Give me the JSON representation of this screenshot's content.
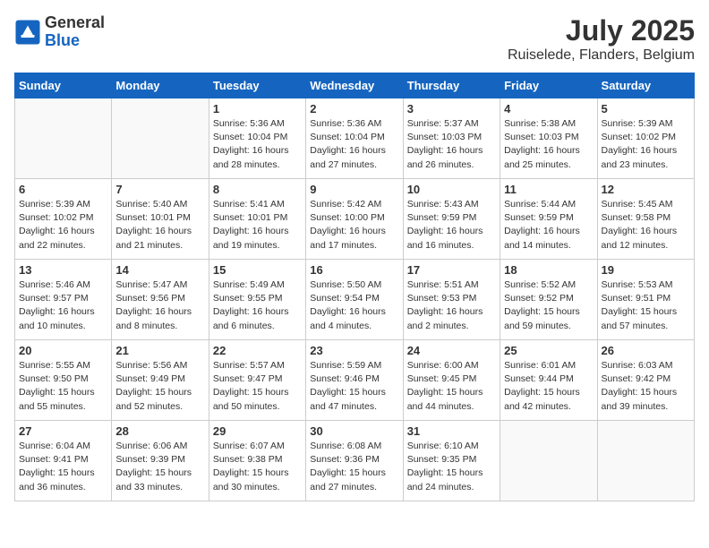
{
  "header": {
    "logo_general": "General",
    "logo_blue": "Blue",
    "month_title": "July 2025",
    "location": "Ruiselede, Flanders, Belgium"
  },
  "weekdays": [
    "Sunday",
    "Monday",
    "Tuesday",
    "Wednesday",
    "Thursday",
    "Friday",
    "Saturday"
  ],
  "weeks": [
    [
      {
        "day": "",
        "info": ""
      },
      {
        "day": "",
        "info": ""
      },
      {
        "day": "1",
        "info": "Sunrise: 5:36 AM\nSunset: 10:04 PM\nDaylight: 16 hours\nand 28 minutes."
      },
      {
        "day": "2",
        "info": "Sunrise: 5:36 AM\nSunset: 10:04 PM\nDaylight: 16 hours\nand 27 minutes."
      },
      {
        "day": "3",
        "info": "Sunrise: 5:37 AM\nSunset: 10:03 PM\nDaylight: 16 hours\nand 26 minutes."
      },
      {
        "day": "4",
        "info": "Sunrise: 5:38 AM\nSunset: 10:03 PM\nDaylight: 16 hours\nand 25 minutes."
      },
      {
        "day": "5",
        "info": "Sunrise: 5:39 AM\nSunset: 10:02 PM\nDaylight: 16 hours\nand 23 minutes."
      }
    ],
    [
      {
        "day": "6",
        "info": "Sunrise: 5:39 AM\nSunset: 10:02 PM\nDaylight: 16 hours\nand 22 minutes."
      },
      {
        "day": "7",
        "info": "Sunrise: 5:40 AM\nSunset: 10:01 PM\nDaylight: 16 hours\nand 21 minutes."
      },
      {
        "day": "8",
        "info": "Sunrise: 5:41 AM\nSunset: 10:01 PM\nDaylight: 16 hours\nand 19 minutes."
      },
      {
        "day": "9",
        "info": "Sunrise: 5:42 AM\nSunset: 10:00 PM\nDaylight: 16 hours\nand 17 minutes."
      },
      {
        "day": "10",
        "info": "Sunrise: 5:43 AM\nSunset: 9:59 PM\nDaylight: 16 hours\nand 16 minutes."
      },
      {
        "day": "11",
        "info": "Sunrise: 5:44 AM\nSunset: 9:59 PM\nDaylight: 16 hours\nand 14 minutes."
      },
      {
        "day": "12",
        "info": "Sunrise: 5:45 AM\nSunset: 9:58 PM\nDaylight: 16 hours\nand 12 minutes."
      }
    ],
    [
      {
        "day": "13",
        "info": "Sunrise: 5:46 AM\nSunset: 9:57 PM\nDaylight: 16 hours\nand 10 minutes."
      },
      {
        "day": "14",
        "info": "Sunrise: 5:47 AM\nSunset: 9:56 PM\nDaylight: 16 hours\nand 8 minutes."
      },
      {
        "day": "15",
        "info": "Sunrise: 5:49 AM\nSunset: 9:55 PM\nDaylight: 16 hours\nand 6 minutes."
      },
      {
        "day": "16",
        "info": "Sunrise: 5:50 AM\nSunset: 9:54 PM\nDaylight: 16 hours\nand 4 minutes."
      },
      {
        "day": "17",
        "info": "Sunrise: 5:51 AM\nSunset: 9:53 PM\nDaylight: 16 hours\nand 2 minutes."
      },
      {
        "day": "18",
        "info": "Sunrise: 5:52 AM\nSunset: 9:52 PM\nDaylight: 15 hours\nand 59 minutes."
      },
      {
        "day": "19",
        "info": "Sunrise: 5:53 AM\nSunset: 9:51 PM\nDaylight: 15 hours\nand 57 minutes."
      }
    ],
    [
      {
        "day": "20",
        "info": "Sunrise: 5:55 AM\nSunset: 9:50 PM\nDaylight: 15 hours\nand 55 minutes."
      },
      {
        "day": "21",
        "info": "Sunrise: 5:56 AM\nSunset: 9:49 PM\nDaylight: 15 hours\nand 52 minutes."
      },
      {
        "day": "22",
        "info": "Sunrise: 5:57 AM\nSunset: 9:47 PM\nDaylight: 15 hours\nand 50 minutes."
      },
      {
        "day": "23",
        "info": "Sunrise: 5:59 AM\nSunset: 9:46 PM\nDaylight: 15 hours\nand 47 minutes."
      },
      {
        "day": "24",
        "info": "Sunrise: 6:00 AM\nSunset: 9:45 PM\nDaylight: 15 hours\nand 44 minutes."
      },
      {
        "day": "25",
        "info": "Sunrise: 6:01 AM\nSunset: 9:44 PM\nDaylight: 15 hours\nand 42 minutes."
      },
      {
        "day": "26",
        "info": "Sunrise: 6:03 AM\nSunset: 9:42 PM\nDaylight: 15 hours\nand 39 minutes."
      }
    ],
    [
      {
        "day": "27",
        "info": "Sunrise: 6:04 AM\nSunset: 9:41 PM\nDaylight: 15 hours\nand 36 minutes."
      },
      {
        "day": "28",
        "info": "Sunrise: 6:06 AM\nSunset: 9:39 PM\nDaylight: 15 hours\nand 33 minutes."
      },
      {
        "day": "29",
        "info": "Sunrise: 6:07 AM\nSunset: 9:38 PM\nDaylight: 15 hours\nand 30 minutes."
      },
      {
        "day": "30",
        "info": "Sunrise: 6:08 AM\nSunset: 9:36 PM\nDaylight: 15 hours\nand 27 minutes."
      },
      {
        "day": "31",
        "info": "Sunrise: 6:10 AM\nSunset: 9:35 PM\nDaylight: 15 hours\nand 24 minutes."
      },
      {
        "day": "",
        "info": ""
      },
      {
        "day": "",
        "info": ""
      }
    ]
  ]
}
